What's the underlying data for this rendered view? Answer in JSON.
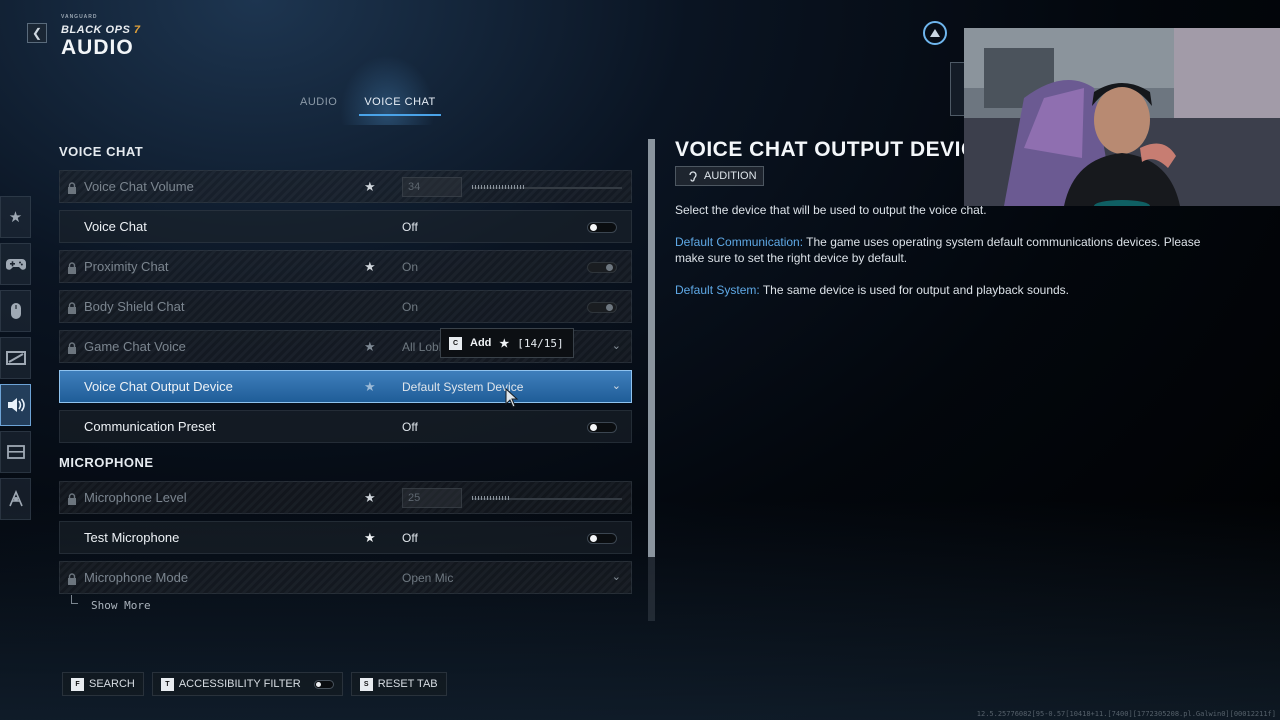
{
  "header": {
    "game_badge": "VANGUARD",
    "game_title": "BLACK OPS",
    "game_title_number": "7",
    "page_title": "AUDIO"
  },
  "tabs": [
    {
      "label": "AUDIO",
      "active": false
    },
    {
      "label": "VOICE CHAT",
      "active": true
    }
  ],
  "rail": {
    "items": [
      {
        "icon": "star-icon"
      },
      {
        "icon": "controller-icon"
      },
      {
        "icon": "mouse-icon"
      },
      {
        "icon": "display-icon"
      },
      {
        "icon": "speaker-icon",
        "active": true
      },
      {
        "icon": "interface-icon"
      },
      {
        "icon": "network-icon"
      }
    ]
  },
  "voice_chat_section": {
    "heading": "VOICE CHAT",
    "rows": [
      {
        "label": "Voice Chat Volume",
        "locked": true,
        "value": "34",
        "slider_fraction": 0.34
      },
      {
        "label": "Voice Chat",
        "value": "Off"
      },
      {
        "label": "Proximity Chat",
        "locked": true,
        "value": "On"
      },
      {
        "label": "Body Shield Chat",
        "locked": true,
        "value": "On"
      },
      {
        "label": "Game Chat Voice",
        "locked": true,
        "value": "All Lobby"
      },
      {
        "label": "Voice Chat Output Device",
        "value": "Default System Device",
        "selected": true
      },
      {
        "label": "Communication Preset",
        "value": "Off"
      }
    ]
  },
  "microphone_section": {
    "heading": "MICROPHONE",
    "rows": [
      {
        "label": "Microphone Level",
        "locked": true,
        "value": "25",
        "slider_fraction": 0.25
      },
      {
        "label": "Test Microphone",
        "value": "Off"
      },
      {
        "label": "Microphone Mode",
        "locked": true,
        "value": "Open Mic"
      }
    ],
    "show_more": "Show More"
  },
  "add_tooltip": {
    "key": "C",
    "label": "Add",
    "count": "[14/15]"
  },
  "details": {
    "title": "VOICE CHAT OUTPUT DEVICE",
    "badge": "AUDITION",
    "description": "Select the device that will be used to output the voice chat.",
    "option1_name": "Default Communication:",
    "option1_text": " The game uses operating system default communications devices. Please make sure to set the right device by default.",
    "option2_name": "Default System:",
    "option2_text": " The same device is used for output and playback sounds."
  },
  "footer": {
    "search": {
      "key": "F",
      "label": "SEARCH"
    },
    "accessibility": {
      "key": "T",
      "label": "ACCESSIBILITY FILTER"
    },
    "reset": {
      "key": "S",
      "label": "RESET TAB"
    }
  },
  "build_string": "12.5.25776082[95-0.57[10418+11.[7400][1772305208.pl.Galwin0][00012211f]",
  "colors": {
    "accent": "#4aa3e8",
    "selected_row": "#2f6fae",
    "highlight_text": "#5fa9e6"
  }
}
